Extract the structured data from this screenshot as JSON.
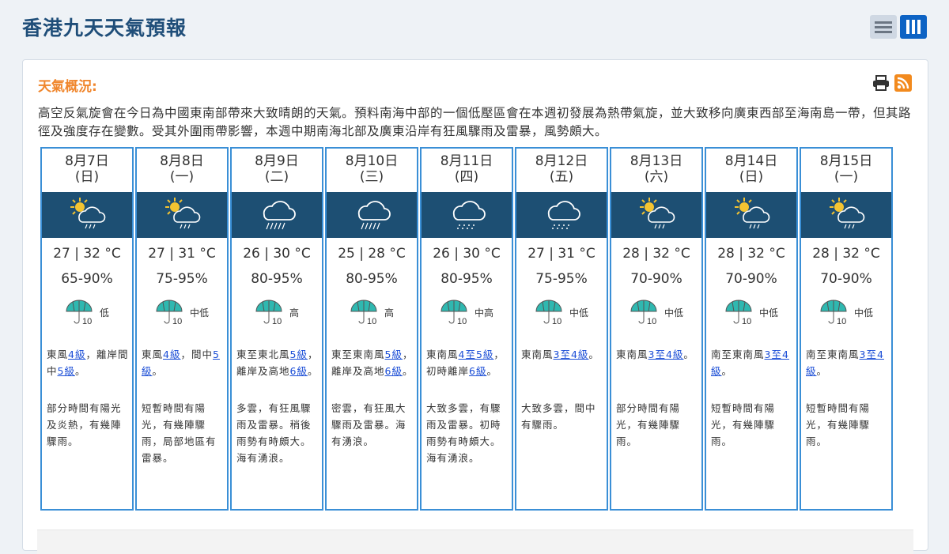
{
  "page": {
    "title": "香港九天天氣預報"
  },
  "overview": {
    "title": "天氣概況:",
    "text": "高空反氣旋會在今日為中國東南部帶來大致晴朗的天氣。預料南海中部的一個低壓區會在本週初發展為熱帶氣旋，並大致移向廣東西部至海南島一帶，但其路徑及強度存在變數。受其外圍雨帶影響，本週中期南海北部及廣東沿岸有狂風驟雨及雷暴，風勢頗大。"
  },
  "icons": {
    "print": "printer-icon",
    "rss": "rss-icon",
    "list_view": "list-view-icon",
    "column_view": "column-view-icon"
  },
  "colors": {
    "accent": "#0d63c4",
    "border": "#3a8fd6",
    "band": "#1d4f73",
    "overview": "#f0862c",
    "link": "#1a4dd6",
    "umbrella": "#2fb8b0"
  },
  "days": [
    {
      "date": "8月7日",
      "weekday": "(日)",
      "icon": "sun-cloud-rain-icon",
      "temp": "27 | 32 °C",
      "rh": "65-90%",
      "psr": "低",
      "wind": [
        [
          "東風",
          false
        ],
        [
          "4級",
          true
        ],
        [
          "，離岸間中",
          false
        ],
        [
          "5級",
          true
        ],
        [
          "。",
          false
        ]
      ],
      "desc": "部分時間有陽光及炎熱，有幾陣驟雨。"
    },
    {
      "date": "8月8日",
      "weekday": "(一)",
      "icon": "sun-cloud-rain-icon",
      "temp": "27 | 31 °C",
      "rh": "75-95%",
      "psr": "中低",
      "wind": [
        [
          "東風",
          false
        ],
        [
          "4級",
          true
        ],
        [
          "，間中",
          false
        ],
        [
          "5級",
          true
        ],
        [
          "。",
          false
        ]
      ],
      "desc": "短暫時間有陽光，有幾陣驟雨，局部地區有雷暴。"
    },
    {
      "date": "8月9日",
      "weekday": "(二)",
      "icon": "heavy-rain-icon",
      "temp": "26 | 30 °C",
      "rh": "80-95%",
      "psr": "高",
      "wind": [
        [
          "東至東北風",
          false
        ],
        [
          "5級",
          true
        ],
        [
          "，離岸及高地",
          false
        ],
        [
          "6級",
          true
        ],
        [
          "。",
          false
        ]
      ],
      "desc": "多雲，有狂風驟雨及雷暴。稍後雨勢有時頗大。海有湧浪。"
    },
    {
      "date": "8月10日",
      "weekday": "(三)",
      "icon": "heavy-rain-icon",
      "temp": "25 | 28 °C",
      "rh": "80-95%",
      "psr": "高",
      "wind": [
        [
          "東至東南風",
          false
        ],
        [
          "5級",
          true
        ],
        [
          "，離岸及高地",
          false
        ],
        [
          "6級",
          true
        ],
        [
          "。",
          false
        ]
      ],
      "desc": "密雲，有狂風大驟雨及雷暴。海有湧浪。"
    },
    {
      "date": "8月11日",
      "weekday": "(四)",
      "icon": "rain-icon",
      "temp": "26 | 30 °C",
      "rh": "80-95%",
      "psr": "中高",
      "wind": [
        [
          "東南風",
          false
        ],
        [
          "4至5級",
          true
        ],
        [
          "，初時離岸",
          false
        ],
        [
          "6級",
          true
        ],
        [
          "。",
          false
        ]
      ],
      "desc": "大致多雲，有驟雨及雷暴。初時雨勢有時頗大。海有湧浪。"
    },
    {
      "date": "8月12日",
      "weekday": "(五)",
      "icon": "rain-icon",
      "temp": "27 | 31 °C",
      "rh": "75-95%",
      "psr": "中低",
      "wind": [
        [
          "東南風",
          false
        ],
        [
          "3至4級",
          true
        ],
        [
          "。",
          false
        ]
      ],
      "desc": "大致多雲，間中有驟雨。"
    },
    {
      "date": "8月13日",
      "weekday": "(六)",
      "icon": "sun-cloud-rain-icon",
      "temp": "28 | 32 °C",
      "rh": "70-90%",
      "psr": "中低",
      "wind": [
        [
          "東南風",
          false
        ],
        [
          "3至4級",
          true
        ],
        [
          "。",
          false
        ]
      ],
      "desc": "部分時間有陽光，有幾陣驟雨。"
    },
    {
      "date": "8月14日",
      "weekday": "(日)",
      "icon": "sun-cloud-rain-icon",
      "temp": "28 | 32 °C",
      "rh": "70-90%",
      "psr": "中低",
      "wind": [
        [
          "南至東南風",
          false
        ],
        [
          "3至4級",
          true
        ],
        [
          "。",
          false
        ]
      ],
      "desc": "短暫時間有陽光，有幾陣驟雨。"
    },
    {
      "date": "8月15日",
      "weekday": "(一)",
      "icon": "sun-cloud-rain-icon",
      "temp": "28 | 32 °C",
      "rh": "70-90%",
      "psr": "中低",
      "wind": [
        [
          "南至東南風",
          false
        ],
        [
          "3至4級",
          true
        ],
        [
          "。",
          false
        ]
      ],
      "desc": "短暫時間有陽光，有幾陣驟雨。"
    }
  ]
}
